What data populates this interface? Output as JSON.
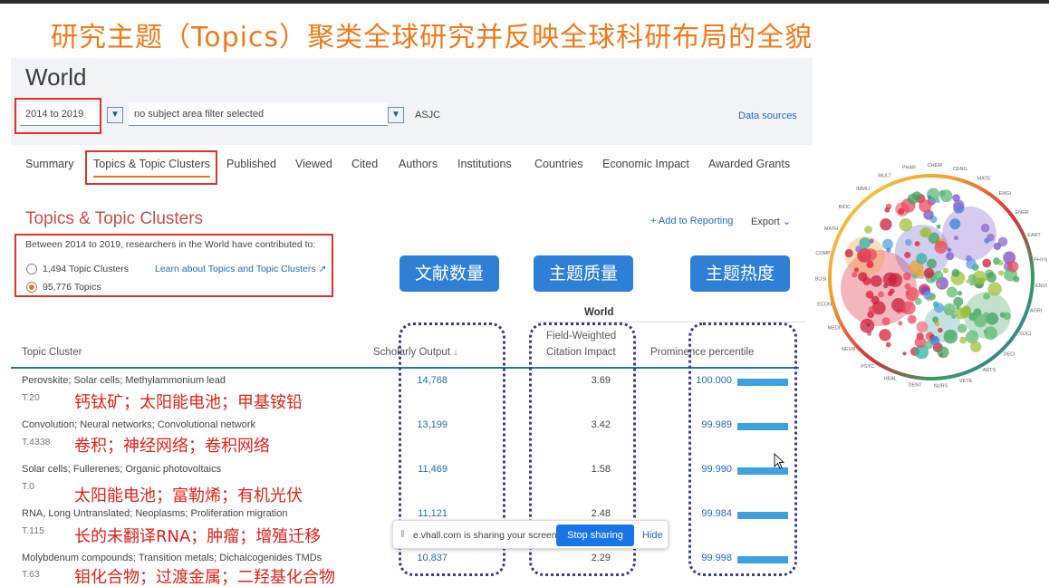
{
  "slide_title": "研究主题（Topics）聚类全球研究并反映全球科研布局的全貌",
  "page_title": "World",
  "filters": {
    "year_range": "2014 to 2019",
    "subject_filter": "no subject area filter selected",
    "scheme": "ASJC",
    "data_sources": "Data sources"
  },
  "tabs": [
    "Summary",
    "Topics & Topic Clusters",
    "Published",
    "Viewed",
    "Cited",
    "Authors",
    "Institutions",
    "Countries",
    "Economic Impact",
    "Awarded Grants"
  ],
  "section": {
    "title": "Topics & Topic Clusters",
    "add_to_reporting": "+ Add to Reporting",
    "export": "Export",
    "intro": "Between 2014 to 2019, researchers in the World have contributed to:",
    "option_clusters": "1,494 Topic Clusters",
    "option_topics": "95,776 Topics",
    "learn_link": "Learn about Topics and Topic Clusters ↗"
  },
  "annotations": {
    "output": "文献数量",
    "quality": "主题质量",
    "prominence": "主题热度"
  },
  "table": {
    "group_header": "World",
    "col_topic": "Topic Cluster",
    "col_output": "Scholarly Output",
    "col_fwci_1": "Field-Weighted",
    "col_fwci_2": "Citation Impact",
    "col_prominence": "Prominence percentile",
    "rows": [
      {
        "topic": "Perovskite; Solar cells; Methylammonium lead",
        "code": "T.20",
        "zh": "钙钛矿；太阳能电池；甲基铵铅",
        "output": "14,768",
        "fwci": "3.69",
        "prominence": "100.000",
        "fill": 1.0
      },
      {
        "topic": "Convolution; Neural networks; Convolutional network",
        "code": "T.4338",
        "zh": "卷积；神经网络；卷积网络",
        "output": "13,199",
        "fwci": "3.42",
        "prominence": "99.989",
        "fill": 0.99989
      },
      {
        "topic": "Solar cells; Fullerenes; Organic photovoltaics",
        "code": "T.0",
        "zh": "太阳能电池；富勒烯；有机光伏",
        "output": "11,469",
        "fwci": "1.58",
        "prominence": "99.990",
        "fill": 0.9999
      },
      {
        "topic": "RNA, Long Untranslated; Neoplasms; Proliferation migration",
        "code": "T.115",
        "zh": "长的未翻译RNA；肿瘤；增殖迁移",
        "output": "11,121",
        "fwci": "2.48",
        "prominence": "99.984",
        "fill": 0.99984
      },
      {
        "topic": "Molybdenum compounds; Transition metals; Dichalcogenides TMDs",
        "code": "T.63",
        "zh": "钼化合物；过渡金属；二羟基化合物",
        "output": "10,837",
        "fwci": "2.29",
        "prominence": "99.998",
        "fill": 0.99998
      }
    ]
  },
  "share_bar": {
    "message": "e.vhall.com is sharing your screen.",
    "stop": "Stop sharing",
    "hide": "Hide"
  },
  "wheel_labels": [
    "BIOC",
    "IMMU",
    "MULT",
    "PHAR",
    "CHEM",
    "CENG",
    "MATE",
    "ENGI",
    "ENER",
    "EART",
    "PHYS",
    "ENVI",
    "AGRI",
    "SOCI",
    "DECI",
    "ARTS",
    "VETE",
    "NURS",
    "DENT",
    "HEAL",
    "PSYC",
    "NEUR",
    "MEDI",
    "ECON",
    "BUSI",
    "COMP",
    "MATH"
  ],
  "colors": {
    "accent_orange": "#f07a1a",
    "annotation_red": "#e0201b",
    "button_blue": "#2f7fd6",
    "bar_blue": "#3fa0e0"
  }
}
